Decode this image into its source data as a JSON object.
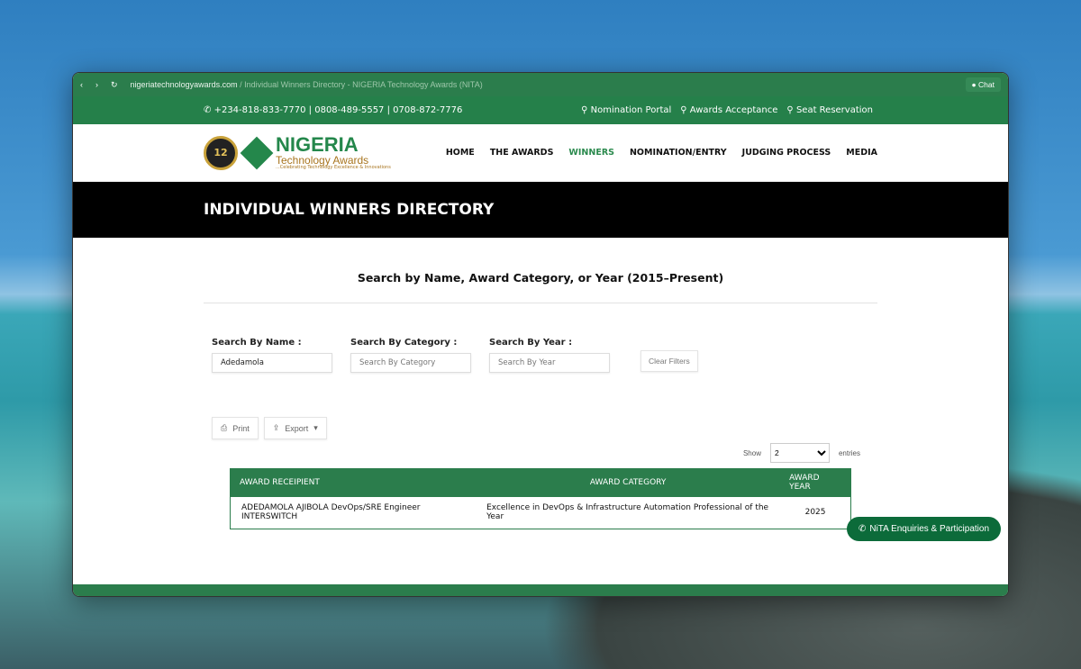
{
  "browser": {
    "domain": "nigeriatechnologyawards.com",
    "title": " / Individual Winners Directory - NIGERIA Technology Awards (NITA)",
    "chat": "Chat"
  },
  "topbar": {
    "phones": "+234-818-833-7770 | 0808-489-5557 | 0708-872-7776",
    "links": [
      "Nomination Portal",
      "Awards Acceptance",
      "Seat Reservation"
    ]
  },
  "logo": {
    "edition": "12",
    "title": "NIGERIA",
    "subtitle": "Technology Awards",
    "tagline": "...Celebrating Technology Excellence & Innovations"
  },
  "nav": [
    "HOME",
    "THE AWARDS",
    "WINNERS",
    "NOMINATION/ENTRY",
    "JUDGING PROCESS",
    "MEDIA"
  ],
  "banner": "INDIVIDUAL WINNERS DIRECTORY",
  "heading": "Search by Name, Award Category, or Year (2015–Present)",
  "filters": {
    "name_label": "Search By Name :",
    "name_value": "Adedamola",
    "category_label": "Search By Category :",
    "category_placeholder": "Search By Category",
    "year_label": "Search By Year :",
    "year_placeholder": "Search By Year",
    "clear": "Clear Filters"
  },
  "actions": {
    "print": "Print",
    "export": "Export"
  },
  "show": {
    "label": "Show",
    "value": "2",
    "suffix": "entries"
  },
  "table": {
    "headers": [
      "AWARD RECEIPIENT",
      "AWARD CATEGORY",
      "AWARD YEAR"
    ],
    "rows": [
      [
        "ADEDAMOLA AJIBOLA DevOps/SRE Engineer INTERSWITCH",
        "Excellence in DevOps & Infrastructure Automation Professional of the Year",
        "2025"
      ]
    ]
  },
  "whatsapp": "NiTA Enquiries & Participation"
}
